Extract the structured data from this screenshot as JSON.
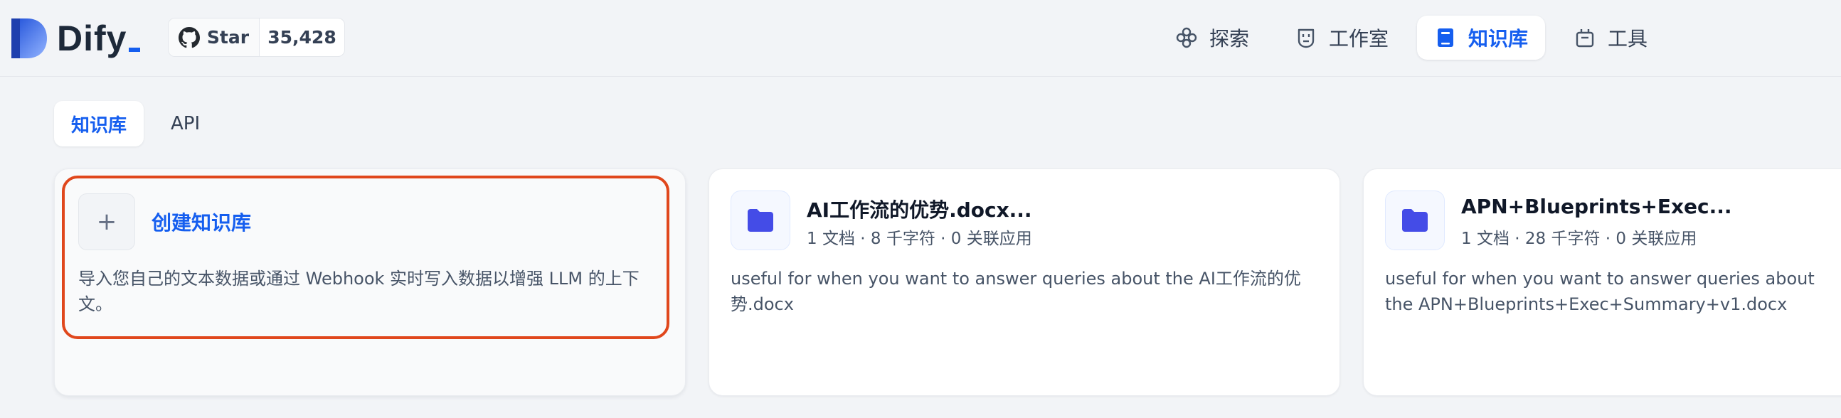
{
  "header": {
    "logo_text": "Dify",
    "github": {
      "star_label": "Star",
      "star_count": "35,428"
    },
    "nav": [
      {
        "label": "探索",
        "icon": "explore-icon"
      },
      {
        "label": "工作室",
        "icon": "robot-icon"
      },
      {
        "label": "知识库",
        "icon": "book-icon",
        "active": true
      },
      {
        "label": "工具",
        "icon": "toolbox-icon"
      }
    ]
  },
  "tabs": [
    {
      "label": "知识库",
      "active": true
    },
    {
      "label": "API",
      "active": false
    }
  ],
  "create_card": {
    "plus": "+",
    "title": "创建知识库",
    "description": "导入您自己的文本数据或通过 Webhook 实时写入数据以增强 LLM 的上下文。"
  },
  "datasets": [
    {
      "name": "AI工作流的优势.docx...",
      "meta": "1 文档 · 8 千字符 · 0 关联应用",
      "description": "useful for when you want to answer queries about the AI工作流的优势.docx"
    },
    {
      "name": "APN+Blueprints+Exec...",
      "meta": "1 文档 · 28 千字符 · 0 关联应用",
      "description": "useful for when you want to answer queries about the APN+Blueprints+Exec+Summary+v1.docx"
    }
  ],
  "colors": {
    "accent": "#155eef",
    "highlight_border": "#e0471c",
    "background": "#f2f4f7",
    "folder_icon": "#444ce7"
  }
}
